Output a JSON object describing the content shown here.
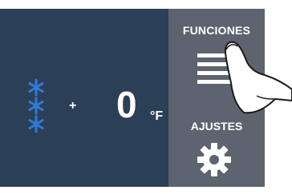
{
  "display": {
    "mode_icon": "snowflake-icon",
    "sign": "+",
    "temperature": "0",
    "unit": "°F"
  },
  "panel": {
    "functions_label": "FUNCIONES",
    "menu_icon": "menu-icon",
    "settings_label": "AJUSTES",
    "settings_icon": "gear-icon"
  },
  "colors": {
    "display_bg": "#2b3f56",
    "panel_bg": "#5d6470",
    "snowflake": "#2f7bd6",
    "text": "#ffffff"
  },
  "overlay": {
    "icon": "pointing-hand-icon"
  }
}
